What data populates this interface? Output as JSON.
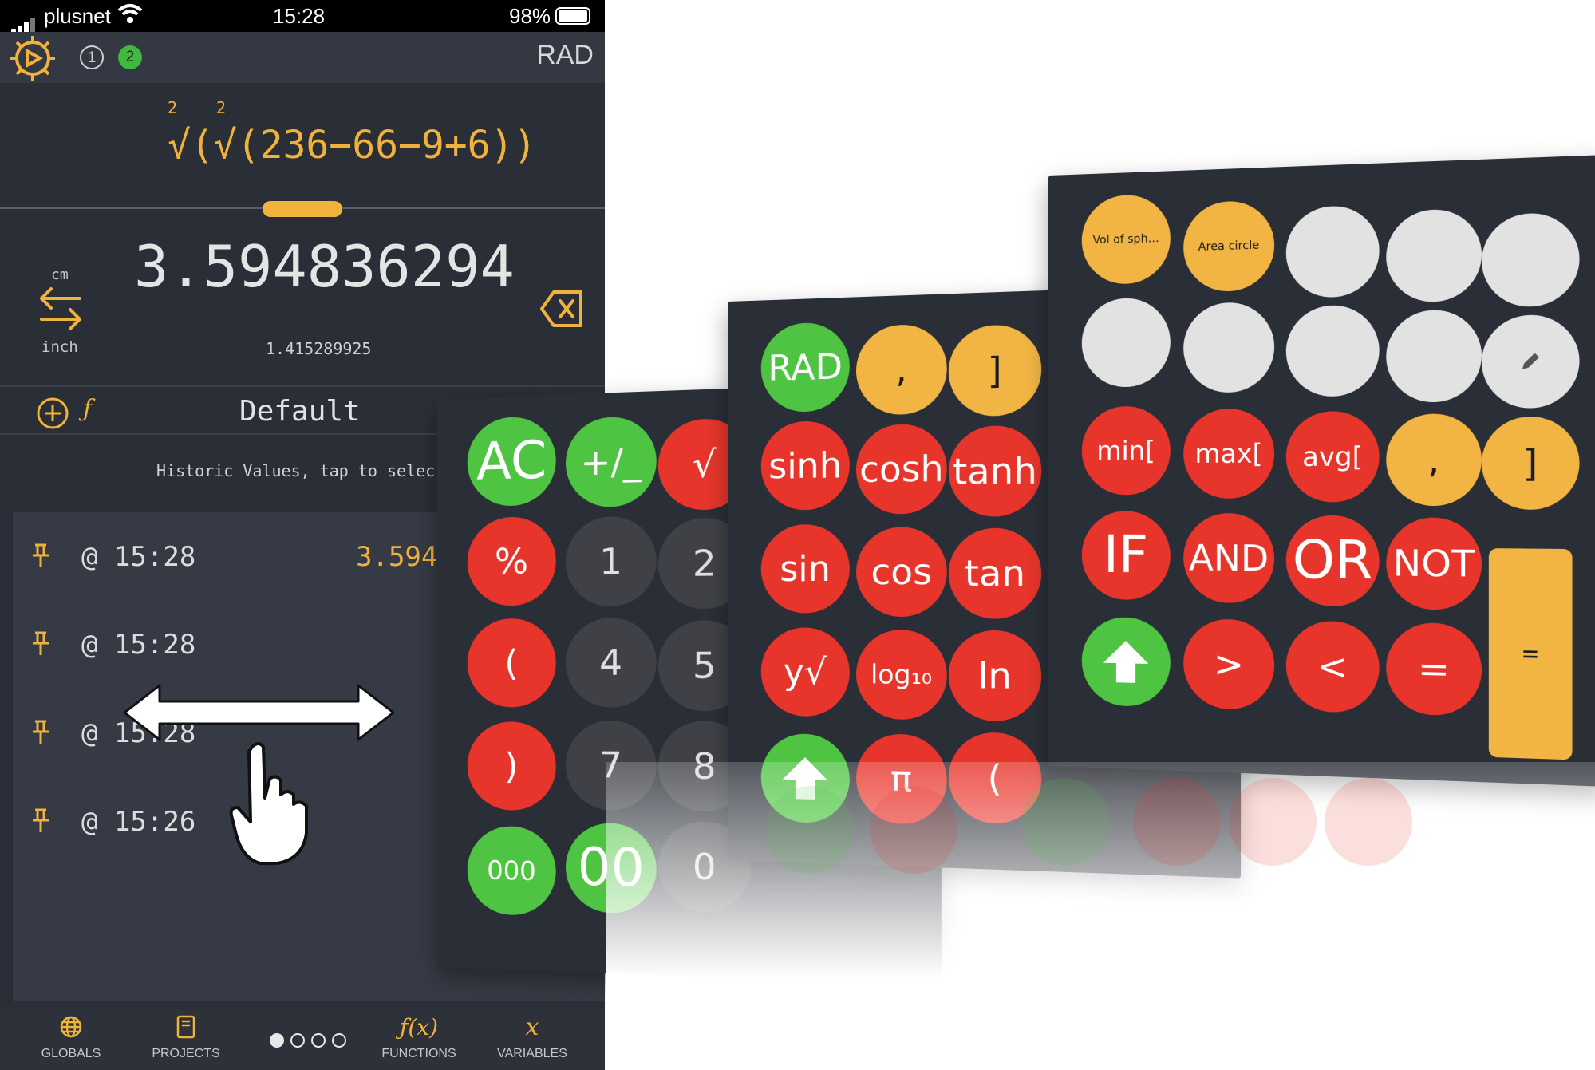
{
  "status_bar": {
    "carrier": "plusnet",
    "time": "15:28",
    "battery": "98%"
  },
  "top_bar": {
    "chip_1": "1",
    "chip_2": "2",
    "angle_mode": "RAD"
  },
  "display": {
    "expression": {
      "root_index_1": "2",
      "root_index_2": "2",
      "body": "√(√(236−66−9+6))"
    },
    "result": "3.594836294",
    "secondary_result": "1.415289925",
    "unit_from": "cm",
    "unit_to": "inch"
  },
  "mode_row": {
    "profile": "Default"
  },
  "history": {
    "hint": "Historic Values, tap to selec",
    "rows": [
      {
        "time": "@ 15:28",
        "value": "3.594"
      },
      {
        "time": "@ 15:28",
        "value": ""
      },
      {
        "time": "@ 15:28",
        "value": ""
      },
      {
        "time": "@ 15:26",
        "value": ""
      }
    ]
  },
  "tab_bar": {
    "globals": "GLOBALS",
    "projects": "PROJECTS",
    "functions": "FUNCTIONS",
    "variables": "VARIABLES",
    "pages": 4,
    "active_page": 1
  },
  "keypad_basic": {
    "keys": [
      "AC",
      "+/_",
      "√",
      "%",
      "1",
      "2",
      "(",
      "4",
      "5",
      ")",
      "7",
      "8",
      "000",
      "00",
      "0"
    ]
  },
  "keypad_scientific": {
    "keys": [
      "RAD",
      ",",
      "]",
      "sinh",
      "cosh",
      "tanh",
      "sin",
      "cos",
      "tan",
      "y√",
      "log₁₀",
      "ln",
      "π",
      "("
    ]
  },
  "keypad_custom": {
    "keys": [
      "Vol of sph…",
      "Area circle",
      "min[",
      "max[",
      "avg[",
      ",",
      "]",
      "IF",
      "AND",
      "OR",
      "NOT",
      ">",
      "<",
      "=",
      "="
    ],
    "edit_icon": "pencil-icon"
  },
  "colors": {
    "accent": "#f0b23a",
    "operator_red": "#e8352b",
    "action_green": "#4ec442",
    "digit_dark": "#3f4146",
    "background": "#2a2e36"
  }
}
